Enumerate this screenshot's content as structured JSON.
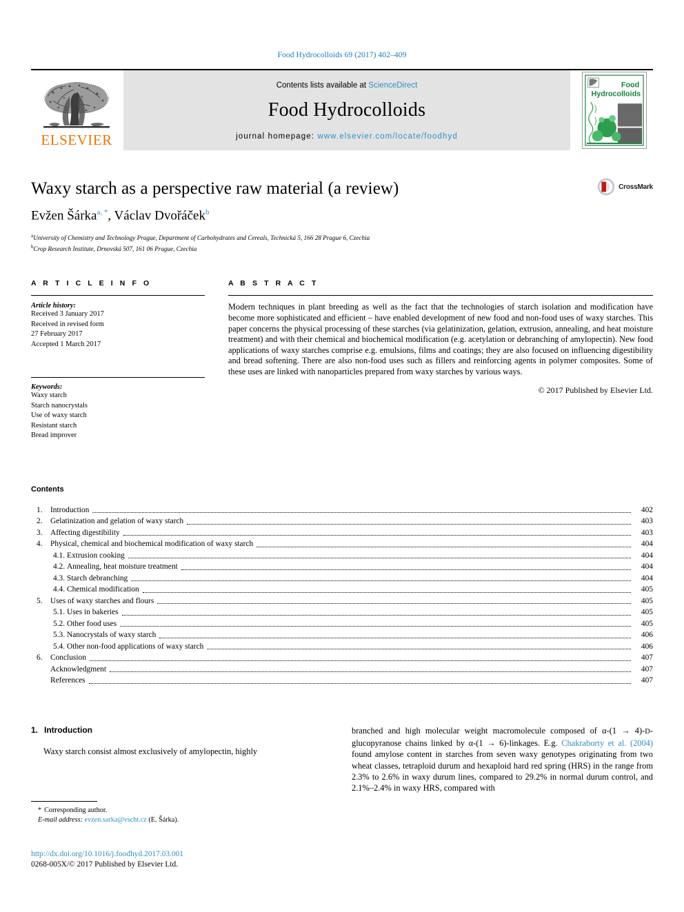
{
  "running_head": "Food Hydrocolloids 69 (2017) 402–409",
  "masthead": {
    "publisher_name": "ELSEVIER",
    "contents_prefix": "Contents lists available at ",
    "contents_link": "ScienceDirect",
    "journal_title": "Food Hydrocolloids",
    "homepage_prefix": "journal homepage: ",
    "homepage_url": "www.elsevier.com/locate/foodhyd",
    "cover_title_line1": "Food",
    "cover_title_line2": "Hydrocolloids",
    "cover_color": "#17833c"
  },
  "title_block": {
    "title": "Waxy starch as a perspective raw material (a review)",
    "authors": [
      {
        "name": "Evžen Šárka",
        "marks": "a, *"
      },
      {
        "name": "Václav Dvořáček",
        "marks": "b"
      }
    ],
    "affiliations": [
      {
        "mark": "a",
        "text": "University of Chemistry and Technology Prague, Department of Carbohydrates and Cereals, Technická 5, 166 28 Prague 6, Czechia"
      },
      {
        "mark": "b",
        "text": "Crop Research Institute, Drnovská 507, 161 06 Prague, Czechia"
      }
    ],
    "crossmark_label": "CrossMark"
  },
  "article_info": {
    "heading": "A R T I C L E  I N F O",
    "history_label": "Article history:",
    "history": [
      "Received 3 January 2017",
      "Received in revised form",
      "27 February 2017",
      "Accepted 1 March 2017"
    ],
    "keywords_label": "Keywords:",
    "keywords": [
      "Waxy starch",
      "Starch nanocrystals",
      "Use of waxy starch",
      "Resistant starch",
      "Bread improver"
    ]
  },
  "abstract": {
    "heading": "A B S T R A C T",
    "text": "Modern techniques in plant breeding as well as the fact that the technologies of starch isolation and modification have become more sophisticated and efficient – have enabled development of new food and non-food uses of waxy starches. This paper concerns the physical processing of these starches (via gelatinization, gelation, extrusion, annealing, and heat moisture treatment) and with their chemical and biochemical modification (e.g. acetylation or debranching of amylopectin). New food applications of waxy starches comprise e.g. emulsions, films and coatings; they are also focused on influencing digestibility and bread softening. There are also non-food uses such as fillers and reinforcing agents in polymer composites. Some of these uses are linked with nanoparticles prepared from waxy starches by various ways.",
    "copyright": "© 2017 Published by Elsevier Ltd."
  },
  "contents": {
    "heading": "Contents",
    "items": [
      {
        "num": "1.",
        "label": "Introduction",
        "page": "402",
        "level": 1
      },
      {
        "num": "2.",
        "label": "Gelatinization and gelation of waxy starch",
        "page": "403",
        "level": 1
      },
      {
        "num": "3.",
        "label": "Affecting digestibility",
        "page": "403",
        "level": 1
      },
      {
        "num": "4.",
        "label": "Physical, chemical and biochemical modification of waxy starch",
        "page": "404",
        "level": 1
      },
      {
        "num": "4.1.",
        "label": "Extrusion cooking",
        "page": "404",
        "level": 2
      },
      {
        "num": "4.2.",
        "label": "Annealing, heat moisture treatment",
        "page": "404",
        "level": 2
      },
      {
        "num": "4.3.",
        "label": "Starch debranching",
        "page": "404",
        "level": 2
      },
      {
        "num": "4.4.",
        "label": "Chemical modification",
        "page": "405",
        "level": 2
      },
      {
        "num": "5.",
        "label": "Uses of waxy starches and flours",
        "page": "405",
        "level": 1
      },
      {
        "num": "5.1.",
        "label": "Uses in bakeries",
        "page": "405",
        "level": 2
      },
      {
        "num": "5.2.",
        "label": "Other food uses",
        "page": "405",
        "level": 2
      },
      {
        "num": "5.3.",
        "label": "Nanocrystals of waxy starch",
        "page": "406",
        "level": 2
      },
      {
        "num": "5.4.",
        "label": "Other non-food applications of waxy starch",
        "page": "406",
        "level": 2
      },
      {
        "num": "6.",
        "label": "Conclusion",
        "page": "407",
        "level": 1
      },
      {
        "num": "",
        "label": "Acknowledgment",
        "page": "407",
        "level": 1
      },
      {
        "num": "",
        "label": "References",
        "page": "407",
        "level": 1
      }
    ]
  },
  "body": {
    "section_number": "1.",
    "section_title": "Introduction",
    "left_paragraph": "Waxy starch consist almost exclusively of amylopectin, highly",
    "right_paragraph_part1": "branched and high molecular weight macromolecule composed of α-(1 → 4)-",
    "right_paragraph_smallcaps": "D",
    "right_paragraph_part2": "-glucopyranose chains linked by α-(1 → 6)-linkages. E.g. ",
    "right_citation": "Chakraborty et al. (2004)",
    "right_paragraph_part3": " found amylose content in starches from seven waxy genotypes originating from two wheat classes, tetraploid durum and hexaploid hard red spring (HRS) in the range from 2.3% to 2.6% in waxy durum lines, compared to 29.2% in normal durum control, and 2.1%–2.4% in waxy HRS, compared with"
  },
  "footnote": {
    "star": "*",
    "corresponding": "Corresponding author.",
    "email_label": "E-mail address:",
    "email": "evzen.sarka@vscht.cz",
    "email_suffix": "(E. Šárka)."
  },
  "publication_footer": {
    "doi": "http://dx.doi.org/10.1016/j.foodhyd.2017.03.001",
    "issn_line": "0268-005X/© 2017 Published by Elsevier Ltd."
  },
  "colors": {
    "link": "#2e8fc4",
    "runhead": "#1a7bb9",
    "elsevier_orange": "#ec7404",
    "band_gray": "#e3e3e3"
  }
}
